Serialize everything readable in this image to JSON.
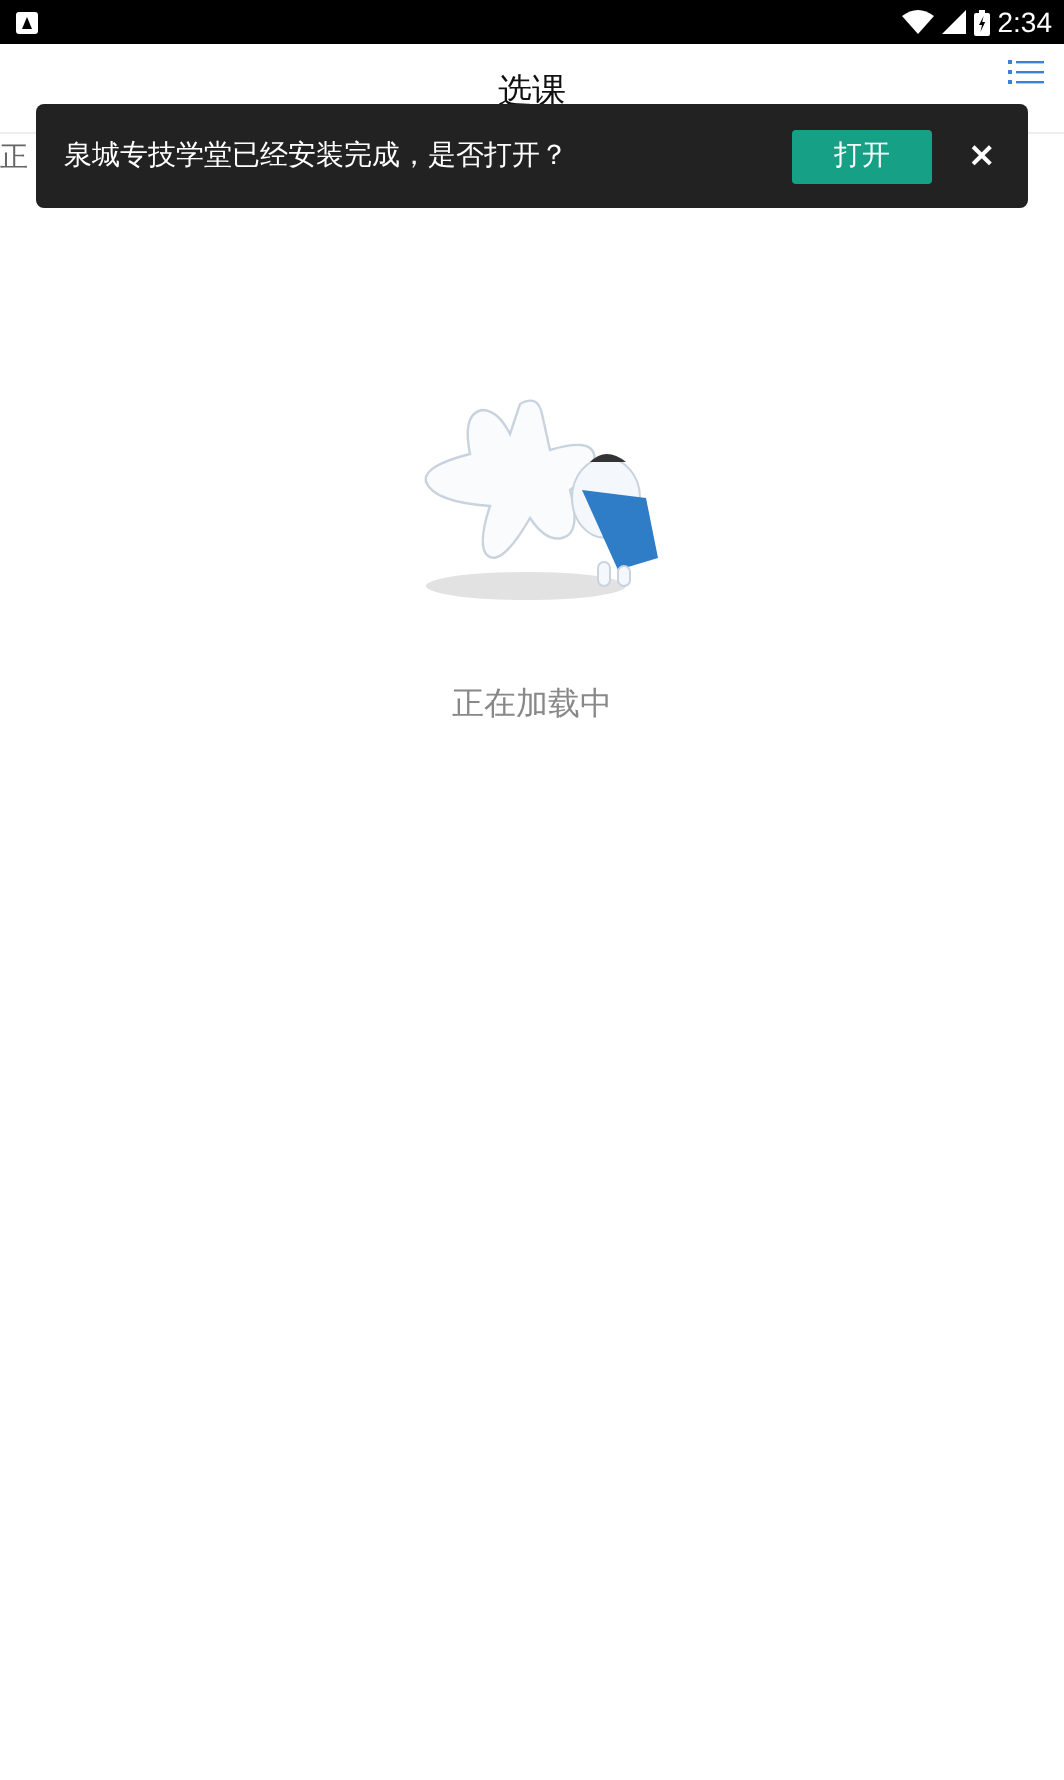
{
  "status_bar": {
    "time": "2:34"
  },
  "header": {
    "title": "选课"
  },
  "partial_text": "正",
  "toast": {
    "message": "泉城专技学堂已经安装完成，是否打开？",
    "action": "打开",
    "close": "×"
  },
  "loading": {
    "text": "正在加载中"
  }
}
